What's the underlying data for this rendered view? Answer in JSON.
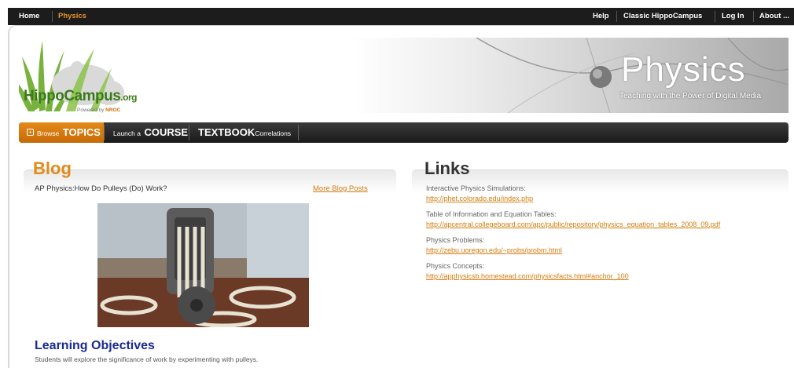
{
  "topnav": {
    "left": [
      "Home",
      "Physics"
    ],
    "right": [
      "Help",
      "Classic HippoCampus",
      "Log In",
      "About ..."
    ]
  },
  "logo": {
    "name_main": "HippoCampus",
    "name_suffix": ".org",
    "powered_prefix": "Powered by",
    "powered_brand": "NROC"
  },
  "banner": {
    "title": "Physics",
    "subtitle": "Teaching with the Power of Digital Media"
  },
  "catnav": {
    "topics_small": "Browse",
    "topics_large": "TOPICS",
    "course_small": "Launch a",
    "course_large": "COURSE",
    "textbook_large": "TEXTBOOK",
    "textbook_small": "Correlations"
  },
  "blog": {
    "heading": "Blog",
    "post_title": "AP Physics:How Do Pulleys (Do) Work?",
    "more_label": "More Blog Posts"
  },
  "learning": {
    "heading": "Learning Objectives",
    "text": "Students will explore the significance of work by experimenting with pulleys."
  },
  "links": {
    "heading": "Links",
    "items": [
      {
        "label": "Interactive Physics Simulations:",
        "url": "http://phet.colorado.edu/index.php"
      },
      {
        "label": "Table of Information and Equation Tables:",
        "url": "http://apcentral.collegeboard.com/apc/public/repository/physics_equation_tables_2008_09.pdf"
      },
      {
        "label": "Physics Problems:",
        "url": "http://zebu.uoregon.edu/~probs/probm.html"
      },
      {
        "label": "Physics Concepts:",
        "url": "http://apphysicsb.homestead.com/physicsfacts.html#anchor_100"
      }
    ]
  },
  "colors": {
    "accent_orange": "#e08a1a",
    "link_orange": "#d77a0a",
    "heading_blue": "#1a2b8c",
    "nav_dark": "#1c1c1c"
  }
}
